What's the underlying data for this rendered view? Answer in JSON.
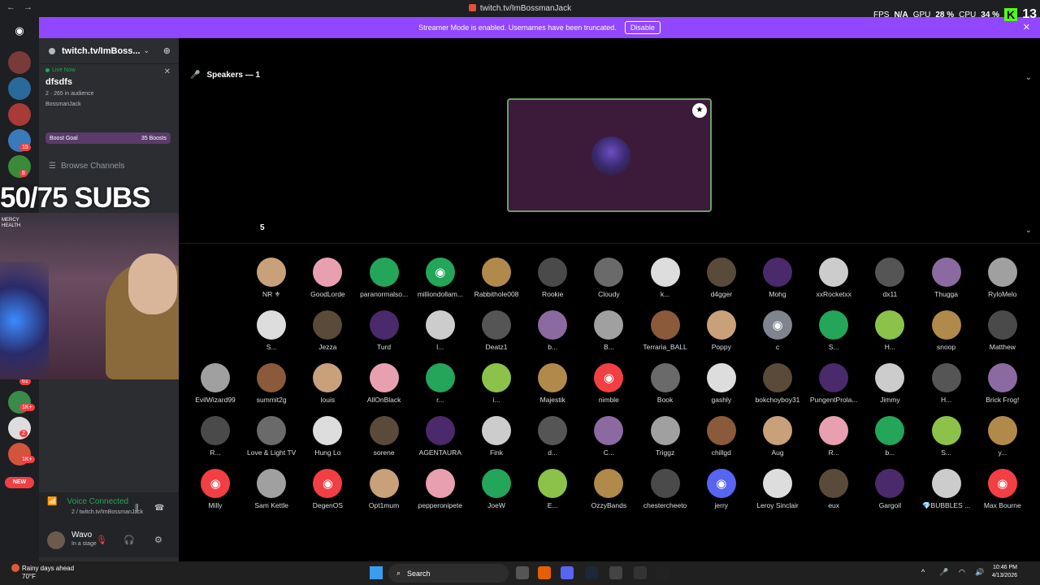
{
  "titlebar": {
    "title": "twitch.tv/ImBossmanJack",
    "back": "←",
    "forward": "→"
  },
  "overlay_stats": {
    "fps_label": "FPS",
    "fps_value": "N/A",
    "gpu_label": "GPU",
    "gpu_value": "28 %",
    "cpu_label": "CPU",
    "cpu_value": "34 %",
    "k_badge": "K",
    "k_count": "13"
  },
  "banner": {
    "text": "Streamer Mode is enabled. Usernames have been truncated.",
    "button": "Disable",
    "close": "✕"
  },
  "rail": {
    "badges": [
      "15",
      "8",
      "61",
      "1K+",
      "1K+",
      "2",
      "1K+"
    ],
    "new_label": "NEW"
  },
  "server": {
    "name": "twitch.tv/ImBoss...",
    "live_label": "Live Now",
    "stream_name": "dfsdfs",
    "audience": "2 · 265 in audience",
    "host": "BossmanJack",
    "boost_label": "Boost Goal",
    "boost_count": "35 Boosts",
    "browse_label": "Browse Channels"
  },
  "voice": {
    "status": "Voice Connected",
    "channel": "2 / twitch.tv/ImBossmanJack"
  },
  "user": {
    "name": "Wavo",
    "status": "In a stage"
  },
  "stage": {
    "speakers_label": "Speakers — 1",
    "audience_label": "5"
  },
  "overlay": {
    "subs_text": "50/75 SUBS",
    "mercy_line1": "MERCY",
    "mercy_line2": "HEALTH"
  },
  "members": [
    [
      "NR ⚜",
      "GoodLorde",
      "paranormalso...",
      "milliondollam...",
      "Rabbithole008",
      "Rookie",
      "Cloudy",
      "k...",
      "d4gger",
      "Mohg",
      "xxRocketxx",
      "dx11",
      "Thugga",
      "RyloMelo"
    ],
    [
      "S...",
      "Jezza",
      "Turd",
      "l...",
      "Deatz1",
      "b...",
      "B...",
      "Terraria_BALL",
      "Poppy",
      "c",
      "S...",
      "H...",
      "snoop",
      "Matthew"
    ],
    [
      "EvilWizard99",
      "summit2g",
      "louis",
      "AllOnBlack",
      "r...",
      "i...",
      "Majestik",
      "nimble",
      "Book",
      "gashly",
      "bokchoyboy31",
      "PungentProla...",
      "Jimmy",
      "H...",
      "Brick Frog!"
    ],
    [
      "R...",
      "Love & Light TV",
      "Hung Lo",
      "sorene",
      "AGENTAURA",
      "Fink",
      "d...",
      "C...",
      "Triggz",
      "chillgd",
      "Aug",
      "R...",
      "b...",
      "S...",
      "y..."
    ],
    [
      "Milly",
      "Sam Kettle",
      "DegenOS",
      "Opt1mum",
      "pepperonipete",
      "JoeW",
      "E...",
      "OzzyBands",
      "chestercheeto",
      "jerry",
      "Leroy Sinclair",
      "eux",
      "Gargoil",
      "💎BUBBLES ...",
      "Max Bourne"
    ]
  ],
  "taskbar": {
    "weather_line1": "Rainy days ahead",
    "weather_line2": "70°F",
    "search": "Search",
    "time": "10:46 PM",
    "date": "4/13/2026"
  }
}
